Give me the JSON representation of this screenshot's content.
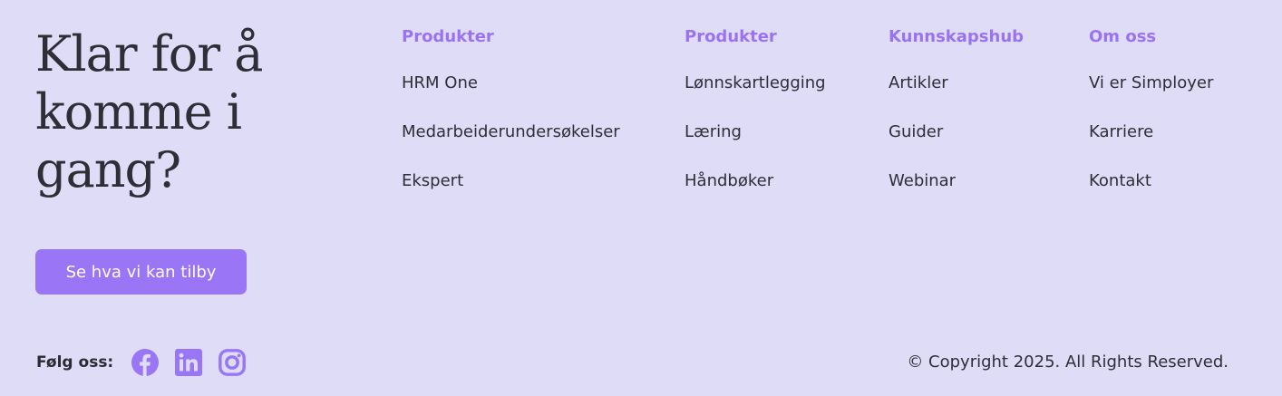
{
  "cta": {
    "heading": "Klar for å komme i gang?",
    "button_label": "Se hva vi kan tilby"
  },
  "nav": {
    "columns": [
      {
        "title": "Produkter",
        "links": [
          "HRM One",
          "Medarbeiderundersøkelser",
          "Ekspert"
        ]
      },
      {
        "title": "Produkter",
        "links": [
          "Lønnskartlegging",
          "Læring",
          "Håndbøker"
        ]
      },
      {
        "title": "Kunnskapshub",
        "links": [
          "Artikler",
          "Guider",
          "Webinar"
        ]
      },
      {
        "title": "Om oss",
        "links": [
          "Vi er Simployer",
          "Karriere",
          "Kontakt"
        ]
      }
    ]
  },
  "social": {
    "label": "Følg oss:",
    "icons": [
      "facebook-icon",
      "linkedin-icon",
      "instagram-icon"
    ]
  },
  "footer": {
    "copyright": "© Copyright 2025. All Rights Reserved."
  },
  "colors": {
    "background": "#dfdcf8",
    "accent": "#9a75f5",
    "heading_accent": "#9b73f1",
    "text": "#2f2d35"
  }
}
